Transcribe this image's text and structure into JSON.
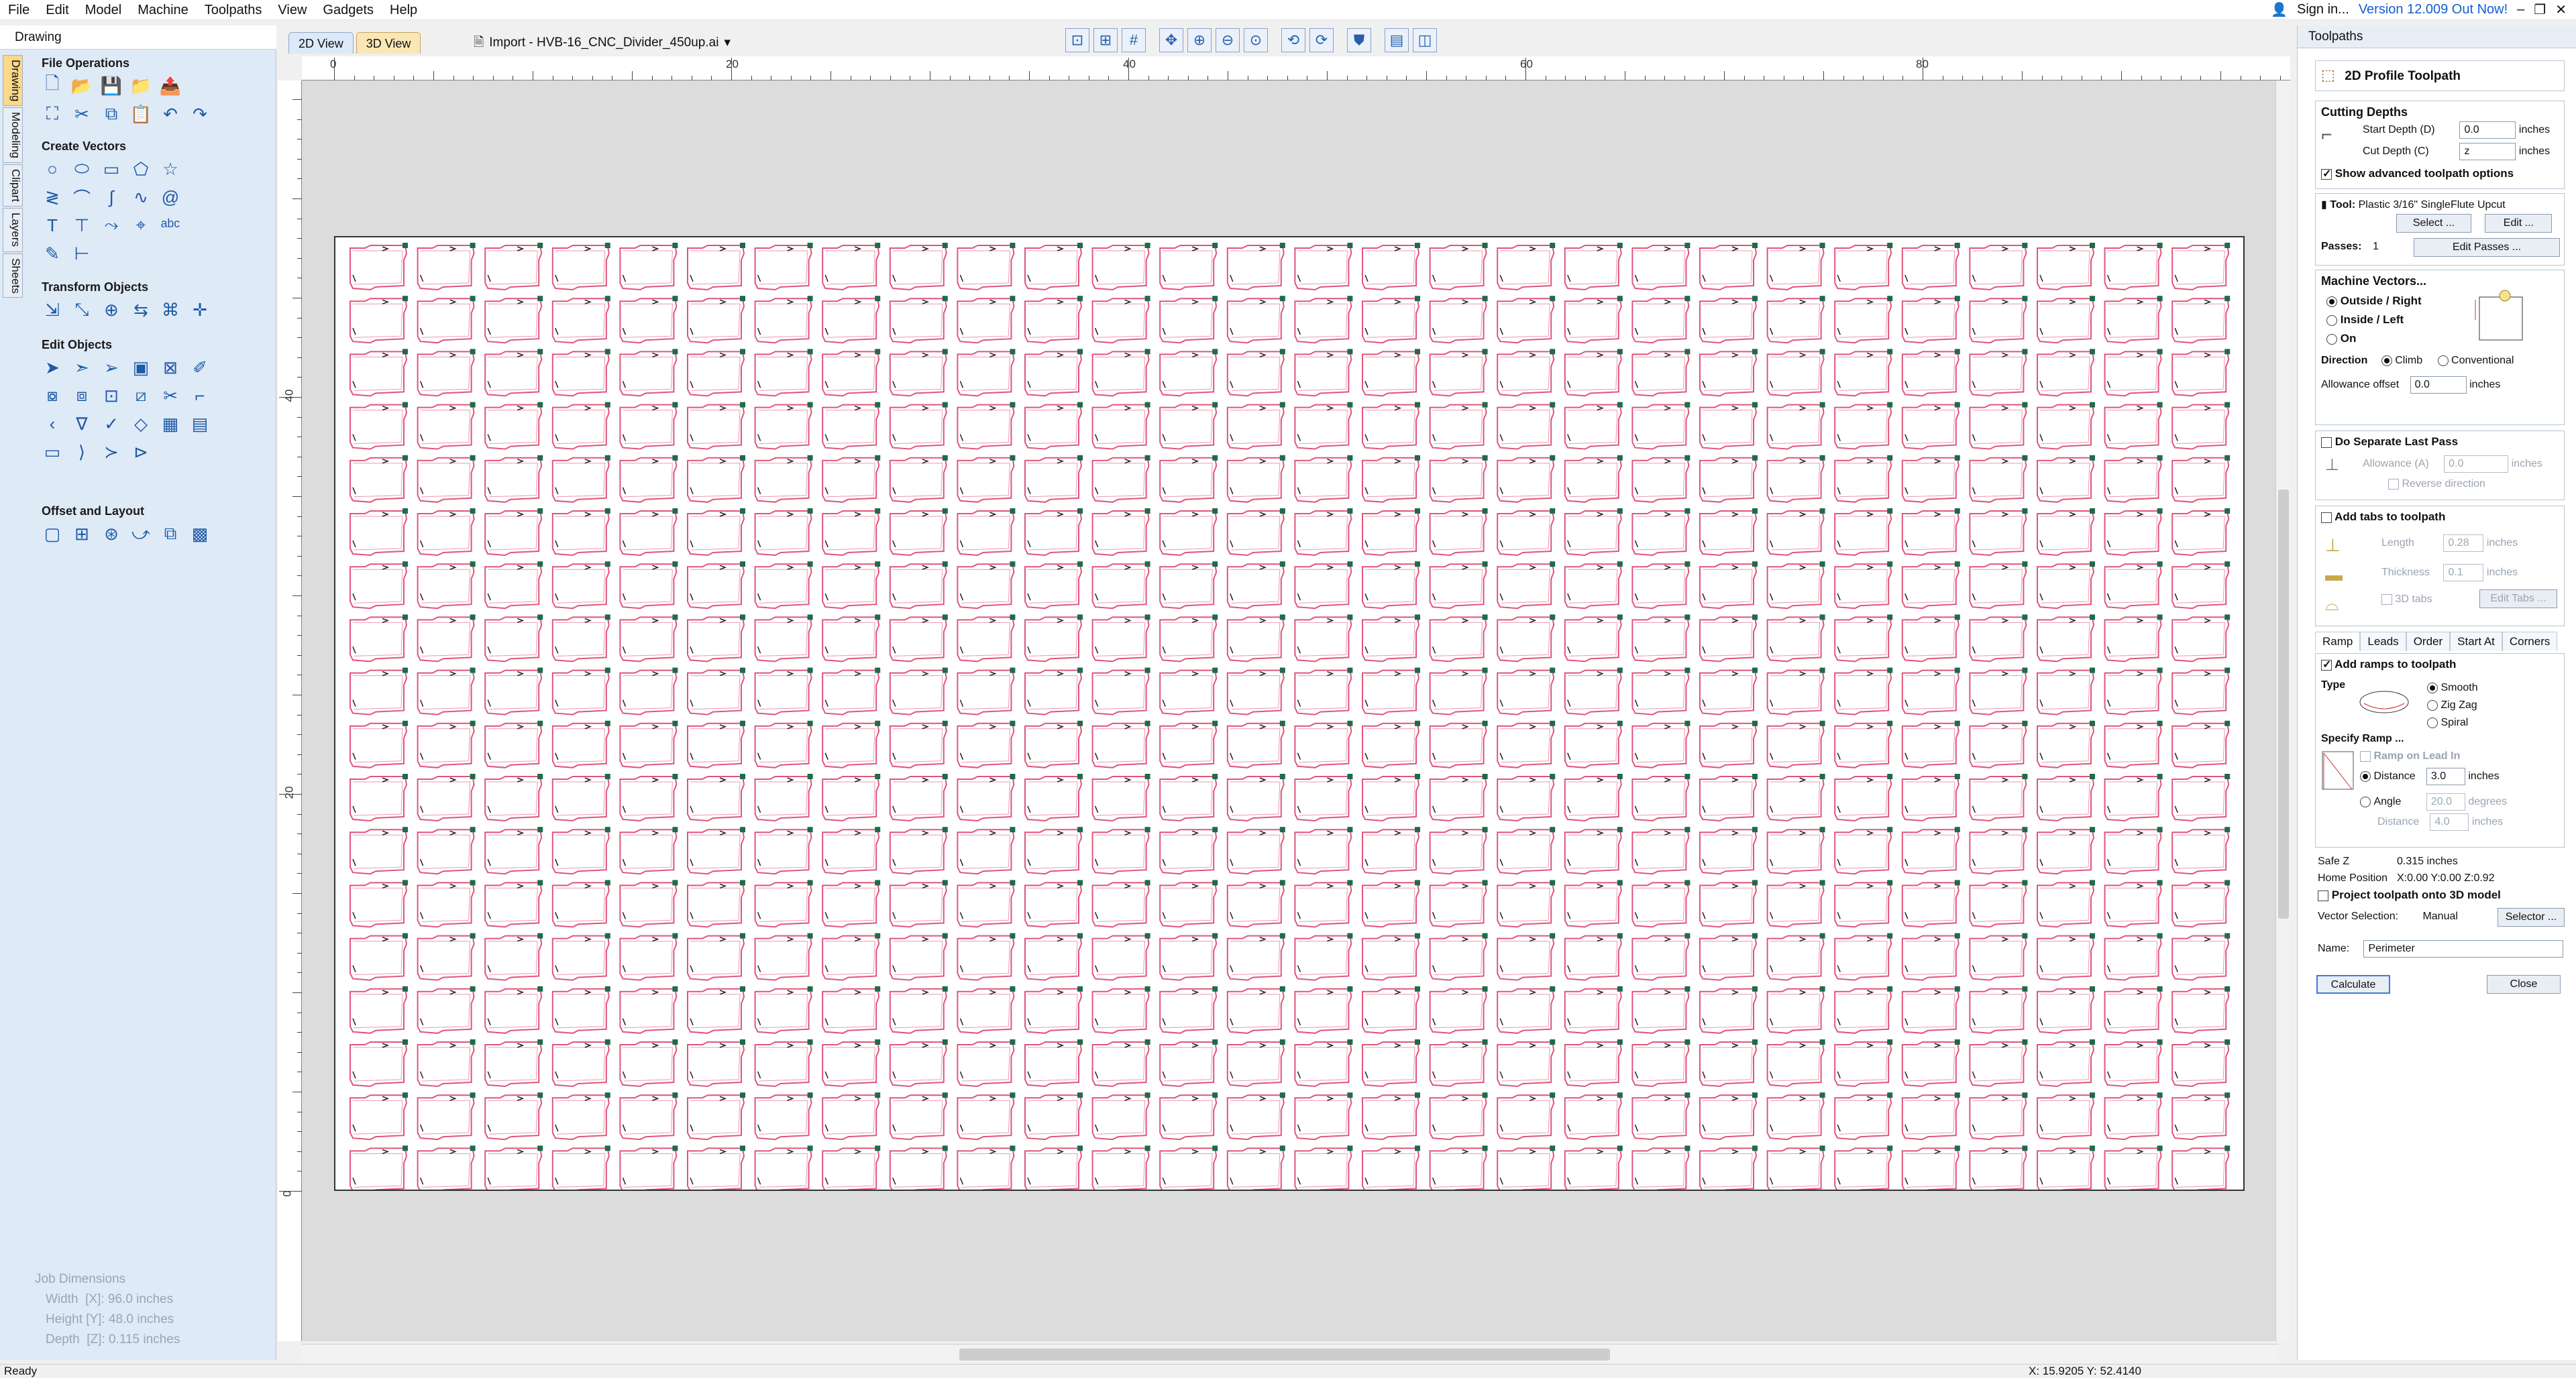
{
  "menu": [
    "File",
    "Edit",
    "Model",
    "Machine",
    "Toolpaths",
    "View",
    "Gadgets",
    "Help"
  ],
  "account": {
    "sign_in": "Sign in...",
    "version": "Version 12.009 Out Now!"
  },
  "left_panel": {
    "title": "Drawing",
    "tabs": [
      "Drawing",
      "Modeling",
      "Clipart",
      "Layers",
      "Sheets"
    ],
    "sections": {
      "file_operations": "File Operations",
      "create_vectors": "Create Vectors",
      "transform_objects": "Transform Objects",
      "edit_objects": "Edit Objects",
      "offset_layout": "Offset and Layout"
    },
    "job_dimensions": {
      "title": "Job Dimensions",
      "width": "Width  [X]: 96.0 inches",
      "height": "Height [Y]: 48.0 inches",
      "depth": "Depth  [Z]: 0.115 inches"
    }
  },
  "view_tabs": [
    "2D View",
    "3D View"
  ],
  "file_indicator": "Import - HVB-16_CNC_Divider_450up.ai",
  "ruler": {
    "top": [
      "0",
      "20",
      "40",
      "60",
      "80"
    ],
    "left": [
      "40",
      "20",
      "0"
    ]
  },
  "status": {
    "left": "Ready",
    "coords": "X: 15.9205 Y: 52.4140"
  },
  "right_panel": {
    "title": "Toolpaths",
    "toolpath_name": "2D Profile Toolpath",
    "cutting_depths": {
      "title": "Cutting Depths",
      "start_label": "Start Depth (D)",
      "start_value": "0.0",
      "cut_label": "Cut Depth (C)",
      "cut_value": "z",
      "unit": "inches"
    },
    "advanced": "Show advanced toolpath options",
    "tool": {
      "label": "Tool:",
      "value": "Plastic 3/16\" SingleFlute Upcut",
      "select": "Select ...",
      "edit": "Edit ..."
    },
    "passes": {
      "label": "Passes:",
      "value": "1",
      "button": "Edit Passes ..."
    },
    "machine_vectors": {
      "title": "Machine Vectors...",
      "options": [
        "Outside / Right",
        "Inside / Left",
        "On"
      ],
      "direction_label": "Direction",
      "climb": "Climb",
      "conventional": "Conventional",
      "allowance_label": "Allowance offset",
      "allowance_value": "0.0",
      "unit": "inches"
    },
    "last_pass": {
      "title": "Do Separate Last Pass",
      "allowance_label": "Allowance (A)",
      "allowance_value": "0.0",
      "unit": "inches",
      "reverse": "Reverse direction"
    },
    "tabs": {
      "title": "Add tabs to toolpath",
      "length_label": "Length",
      "length_value": "0.28",
      "thickness_label": "Thickness",
      "thickness_value": "0.1",
      "unit": "inches",
      "tabs3d": "3D tabs",
      "edit": "Edit Tabs ..."
    },
    "subtabs": [
      "Ramp",
      "Leads",
      "Order",
      "Start At",
      "Corners"
    ],
    "ramps": {
      "title": "Add ramps to toolpath",
      "type_label": "Type",
      "types": [
        "Smooth",
        "Zig Zag",
        "Spiral"
      ],
      "specify": "Specify Ramp ...",
      "lead_in": "Ramp on Lead In",
      "distance_label": "Distance",
      "distance_value": "3.0",
      "angle_label": "Angle",
      "angle_value": "20.0",
      "degrees": "degrees",
      "distance2_label": "Distance",
      "distance2_value": "4.0",
      "unit": "inches"
    },
    "safe_z": {
      "label": "Safe Z",
      "value": "0.315 inches"
    },
    "home": {
      "label": "Home Position",
      "value": "X:0.00 Y:0.00 Z:0.92"
    },
    "project": "Project toolpath onto 3D model",
    "vector_selection": {
      "label": "Vector Selection:",
      "value": "Manual",
      "button": "Selector ..."
    },
    "name": {
      "label": "Name:",
      "value": "Perimeter"
    },
    "calculate": "Calculate",
    "close": "Close"
  },
  "colors": {
    "vector_stroke": "#e0557a",
    "node": "#1e6b4a",
    "sheet_border": "#333333"
  },
  "grid": {
    "columns": 28,
    "rows": 18
  }
}
